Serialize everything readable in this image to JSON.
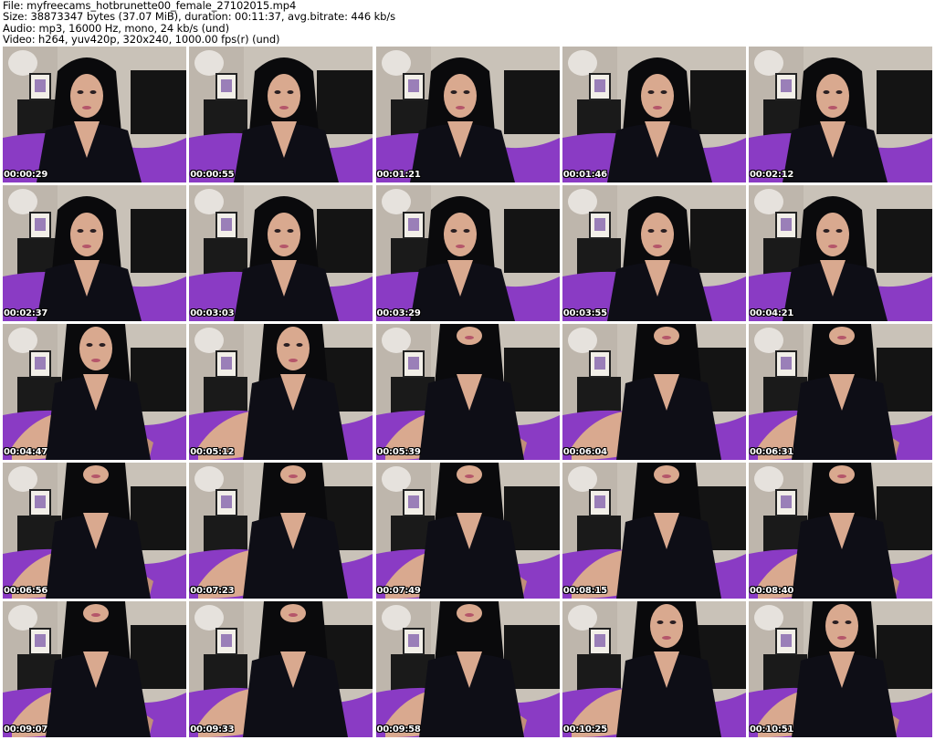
{
  "header": {
    "file_line": "File: myfreecams_hotbrunette00_female_27102015.mp4",
    "size_line": "Size: 38873347 bytes (37.07 MiB), duration: 00:11:37, avg.bitrate: 446 kb/s",
    "audio_line": "Audio: mp3, 16000 Hz, mono, 24 kb/s (und)",
    "video_line": "Video: h264, yuv420p, 320x240, 1000.00 fps(r) (und)"
  },
  "colors": {
    "wall": "#c9c2b8",
    "purple_bedding": "#8a3bc4",
    "black_clothing": "#0e0e16",
    "skin": "#d9a98f",
    "hair": "#0a0a0c",
    "furniture": "#1a1a1a"
  },
  "thumbnails": [
    {
      "time": "00:00:29"
    },
    {
      "time": "00:00:55"
    },
    {
      "time": "00:01:21"
    },
    {
      "time": "00:01:46"
    },
    {
      "time": "00:02:12"
    },
    {
      "time": "00:02:37"
    },
    {
      "time": "00:03:03"
    },
    {
      "time": "00:03:29"
    },
    {
      "time": "00:03:55"
    },
    {
      "time": "00:04:21"
    },
    {
      "time": "00:04:47"
    },
    {
      "time": "00:05:12"
    },
    {
      "time": "00:05:39"
    },
    {
      "time": "00:06:04"
    },
    {
      "time": "00:06:31"
    },
    {
      "time": "00:06:56"
    },
    {
      "time": "00:07:23"
    },
    {
      "time": "00:07:49"
    },
    {
      "time": "00:08:15"
    },
    {
      "time": "00:08:40"
    },
    {
      "time": "00:09:07"
    },
    {
      "time": "00:09:33"
    },
    {
      "time": "00:09:58"
    },
    {
      "time": "00:10:25"
    },
    {
      "time": "00:10:51"
    }
  ]
}
